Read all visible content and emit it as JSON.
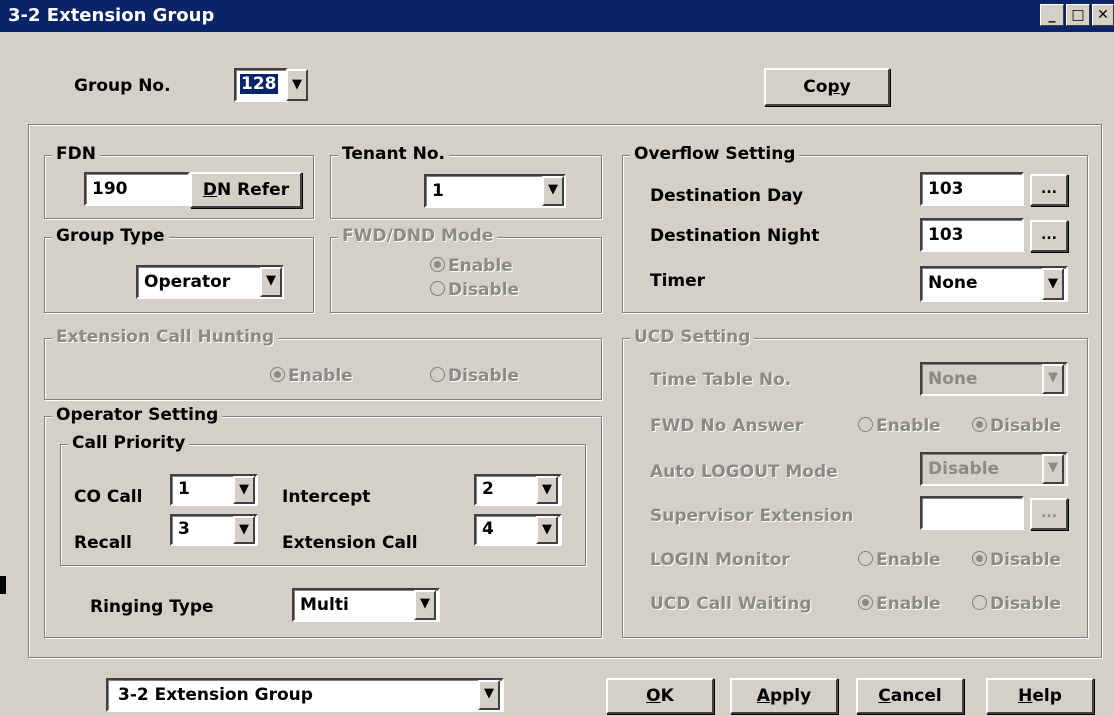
{
  "window": {
    "title": "3-2 Extension Group",
    "minimize_icon": "minimize-icon",
    "maximize_icon": "maximize-icon",
    "close_icon": "close-icon"
  },
  "group_no": {
    "label": "Group No.",
    "value": "128"
  },
  "copy_button": {
    "pre": "Co",
    "mnemonic": "p",
    "post": "y"
  },
  "fdn": {
    "title": "FDN",
    "value": "190",
    "refer_pre": "",
    "refer_mnemonic": "D",
    "refer_post": "N Refer"
  },
  "tenant": {
    "title": "Tenant No.",
    "value": "1"
  },
  "group_type": {
    "title": "Group Type",
    "value": "Operator"
  },
  "fwd_dnd": {
    "title": "FWD/DND Mode",
    "enable": "Enable",
    "disable": "Disable",
    "selected": "enable"
  },
  "hunting": {
    "title": "Extension Call Hunting",
    "enable": "Enable",
    "disable": "Disable",
    "selected": "enable"
  },
  "operator": {
    "title": "Operator Setting",
    "call_priority": {
      "title": "Call Priority",
      "co_call_label": "CO Call",
      "co_call_value": "1",
      "intercept_label": "Intercept",
      "intercept_value": "2",
      "recall_label": "Recall",
      "recall_value": "3",
      "extension_call_label": "Extension Call",
      "extension_call_value": "4"
    },
    "ringing_label": "Ringing Type",
    "ringing_value": "Multi"
  },
  "overflow": {
    "title": "Overflow Setting",
    "day_label": "Destination Day",
    "day_value": "103",
    "night_label": "Destination Night",
    "night_value": "103",
    "timer_label": "Timer",
    "timer_value": "None",
    "ellipsis": "..."
  },
  "ucd": {
    "title": "UCD Setting",
    "time_table_label": "Time Table No.",
    "time_table_value": "None",
    "fwd_no_answer_label": "FWD No Answer",
    "auto_logout_label": "Auto LOGOUT Mode",
    "auto_logout_value": "Disable",
    "supervisor_label": "Supervisor Extension",
    "supervisor_value": "",
    "login_monitor_label": "LOGIN Monitor",
    "call_waiting_label": "UCD Call Waiting",
    "enable": "Enable",
    "disable": "Disable",
    "ellipsis": "..."
  },
  "footer": {
    "page_select": "3-2 Extension Group",
    "ok": {
      "mnemonic": "O",
      "post": "K"
    },
    "apply": {
      "mnemonic": "A",
      "post": "pply"
    },
    "cancel": {
      "mnemonic": "C",
      "post": "ancel"
    },
    "help": {
      "mnemonic": "H",
      "post": "elp"
    }
  },
  "arrow_glyph": "▼"
}
